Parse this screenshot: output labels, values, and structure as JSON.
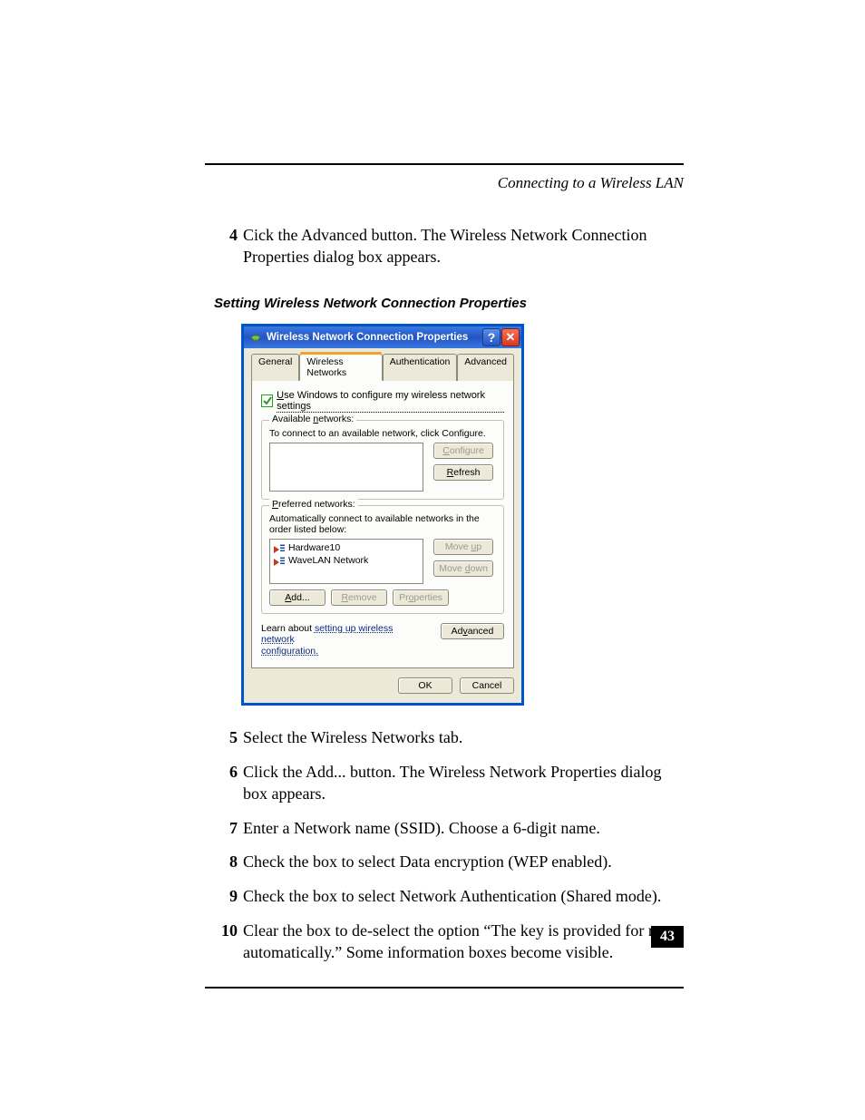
{
  "header": {
    "title": "Connecting to a Wireless LAN"
  },
  "steps_top": [
    {
      "n": "4",
      "text": "Cick the Advanced button. The Wireless Network Connection Properties dialog box appears."
    }
  ],
  "caption": "Setting Wireless Network Connection Properties",
  "dialog": {
    "title": "Wireless Network Connection Properties",
    "help_symbol": "?",
    "close_symbol": "✕",
    "tabs": [
      "General",
      "Wireless Networks",
      "Authentication",
      "Advanced"
    ],
    "active_tab": 1,
    "use_windows_prefix": "U",
    "use_windows_rest": "se Windows to configure my wireless network settings",
    "available": {
      "legend_prefix": "Available ",
      "legend_u": "n",
      "legend_rest": "etworks:",
      "hint": "To connect to an available network, click Configure.",
      "buttons": {
        "configure_u": "C",
        "configure_rest": "onfigure",
        "refresh_u": "R",
        "refresh_rest": "efresh"
      }
    },
    "preferred": {
      "legend_u": "P",
      "legend_rest": "referred networks:",
      "hint": "Automatically connect to available networks in the order listed below:",
      "items": [
        "Hardware10",
        "WaveLAN Network"
      ],
      "moveup_prefix": "Move ",
      "moveup_u": "u",
      "moveup_rest": "p",
      "movedown_prefix": "Move ",
      "movedown_u": "d",
      "movedown_rest": "own",
      "add_u": "A",
      "add_rest": "dd...",
      "remove_u": "R",
      "remove_rest": "emove",
      "props_prefix": "Pr",
      "props_u": "o",
      "props_rest": "perties"
    },
    "learn_prefix": "Learn about ",
    "learn_link1": "setting up wireless network",
    "learn_link2": "configuration.",
    "advanced_prefix": "Ad",
    "advanced_u": "v",
    "advanced_rest": "anced",
    "ok": "OK",
    "cancel": "Cancel"
  },
  "steps_bottom": [
    {
      "n": "5",
      "text": "Select the Wireless Networks tab."
    },
    {
      "n": "6",
      "text": "Click the Add... button. The Wireless Network Properties dialog box appears."
    },
    {
      "n": "7",
      "text": "Enter a Network name (SSID). Choose a 6-digit name."
    },
    {
      "n": "8",
      "text": "Check the box to select Data encryption (WEP enabled)."
    },
    {
      "n": "9",
      "text": "Check the box to select Network Authentication (Shared mode)."
    },
    {
      "n": "10",
      "text": "Clear the box to de-select the option “The key is provided for me automatically.” Some information boxes become visible."
    }
  ],
  "page_number": "43"
}
